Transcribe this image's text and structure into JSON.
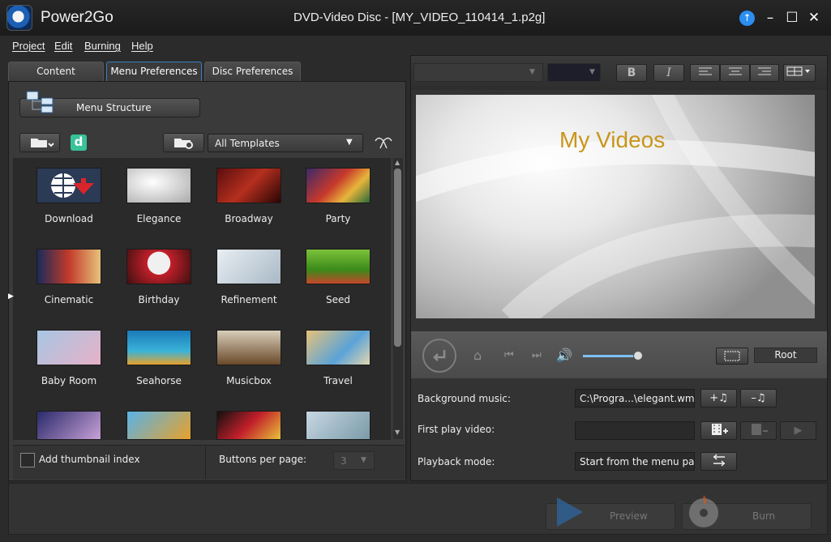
{
  "app": {
    "name": "Power2Go",
    "window_title": "DVD-Video Disc - [MY_VIDEO_110414_1.p2g]"
  },
  "menu": [
    "Project",
    "Edit",
    "Burning",
    "Help"
  ],
  "tabs": [
    "Content",
    "Menu Preferences",
    "Disc Preferences"
  ],
  "menu_structure": {
    "label": "Menu Structure"
  },
  "template_filter": {
    "selected": "All Templates"
  },
  "templates": [
    {
      "name": "Download"
    },
    {
      "name": "Elegance"
    },
    {
      "name": "Broadway"
    },
    {
      "name": "Party"
    },
    {
      "name": "Cinematic"
    },
    {
      "name": "Birthday"
    },
    {
      "name": "Refinement"
    },
    {
      "name": "Seed"
    },
    {
      "name": "Baby Room"
    },
    {
      "name": "Seahorse"
    },
    {
      "name": "Musicbox"
    },
    {
      "name": "Travel"
    }
  ],
  "options": {
    "thumbnail_index_label": "Add thumbnail index",
    "buttons_per_page_label": "Buttons per page:",
    "buttons_per_page_value": "3"
  },
  "preview": {
    "title_text": "My Videos"
  },
  "format": {
    "bold": "B",
    "italic": "I"
  },
  "player": {
    "root_label": "Root",
    "volume": 0.95
  },
  "properties": {
    "background_music": {
      "label": "Background music:",
      "value": "C:\\Progra...\\elegant.wma"
    },
    "first_play_video": {
      "label": "First play video:",
      "value": ""
    },
    "playback_mode": {
      "label": "Playback mode:",
      "value": "Start from the menu pa..."
    }
  },
  "actions": {
    "preview": "Preview",
    "burn": "Burn"
  }
}
